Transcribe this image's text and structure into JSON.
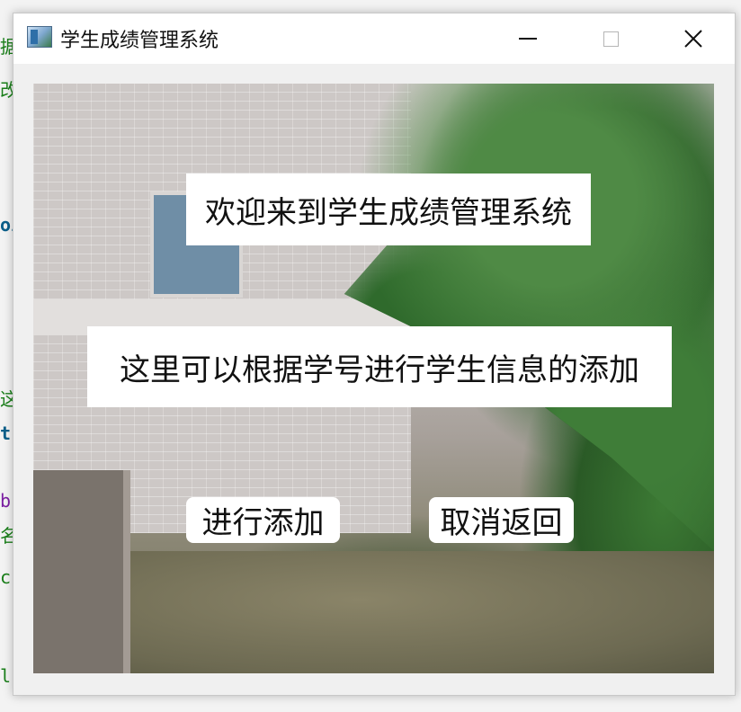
{
  "background_code": {
    "frag1": "据",
    "frag2": "改",
    "frag3": "oi",
    "frag4": "这",
    "frag5": "t",
    "frag6": "b",
    "frag7": "名",
    "frag8": "c",
    "frag9": "l"
  },
  "window": {
    "title": "学生成绩管理系统",
    "icon": "app-window-icon",
    "controls": {
      "minimize_icon": "minimize-icon",
      "maximize_icon": "maximize-icon",
      "close_icon": "close-icon"
    }
  },
  "main": {
    "welcome_text": "欢迎来到学生成绩管理系统",
    "info_text": "这里可以根据学号进行学生信息的添加",
    "add_button_label": "进行添加",
    "cancel_button_label": "取消返回"
  },
  "colors": {
    "titlebar_bg": "#ffffff",
    "window_bg": "#f0f0f0",
    "label_bg": "#ffffff",
    "text": "#111111"
  }
}
